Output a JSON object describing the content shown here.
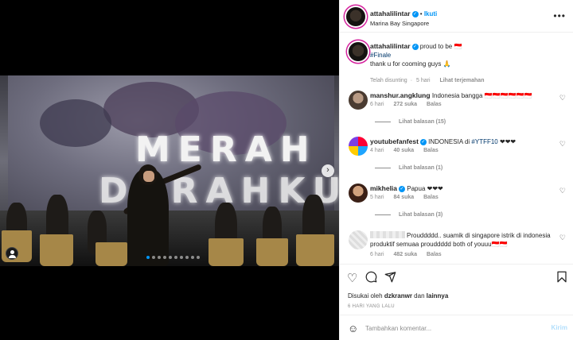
{
  "post": {
    "scene_text_line1": "MERAH",
    "scene_text_line2": "DARAHKU",
    "carousel_count": 10,
    "carousel_active": 1
  },
  "header": {
    "username": "attahalilintar",
    "follow_separator": "•",
    "follow_label": "Ikuti",
    "location": "Marina Bay Singapore",
    "more_label": "•••"
  },
  "caption": {
    "username": "attahalilintar",
    "text": "proud to be 🇮🇩",
    "hashtag": "#Finale",
    "line3": "thank u for cooming guys 🙏",
    "edited": "Telah disunting",
    "time": "5 hari",
    "translate": "Lihat terjemahan"
  },
  "comments": [
    {
      "username": "manshur.angklung",
      "verified": false,
      "text": "Indonesia bangga 🇮🇩🇮🇩🇮🇩🇮🇩🇮🇩🇮🇩",
      "tag": "",
      "time": "6 hari",
      "likes": "272 suka",
      "reply": "Balas",
      "replies": "Lihat balasan (15)"
    },
    {
      "username": "youtubefanfest",
      "verified": true,
      "text": "INDONESIA di",
      "tag": "#YTFF10",
      "tail": "❤❤❤",
      "time": "4 hari",
      "likes": "40 suka",
      "reply": "Balas",
      "replies": "Lihat balasan (1)"
    },
    {
      "username": "mikhelia",
      "verified": true,
      "text": "Papua ❤❤❤",
      "tag": "",
      "time": "5 hari",
      "likes": "84 suka",
      "reply": "Balas",
      "replies": "Lihat balasan (3)"
    },
    {
      "username": "",
      "verified": false,
      "text": "Prouddddd.. suamik di singapore istrik di indonesia produktif semuaa prouddddd both of youuu🇮🇩🇮🇩",
      "tag": "",
      "time": "6 hari",
      "likes": "482 suka",
      "reply": "Balas",
      "replies": ""
    }
  ],
  "footer": {
    "liked_by_prefix": "Disukai oleh",
    "liked_by_user": "dzkranwr",
    "liked_by_and": "dan",
    "liked_by_others": "lainnya",
    "ago": "6 HARI YANG LALU",
    "comment_placeholder": "Tambahkan komentar...",
    "send_label": "Kirim"
  },
  "icons": {
    "heart": "heart-icon",
    "comment": "comment-icon",
    "share": "share-icon",
    "save": "bookmark-icon",
    "emoji": "emoji-icon",
    "next": "chevron-right-icon",
    "tag": "user-tag-icon"
  },
  "colors": {
    "accent": "#0095f6",
    "secondary_text": "#8e8e8e",
    "story_ring": "#d6249f"
  }
}
